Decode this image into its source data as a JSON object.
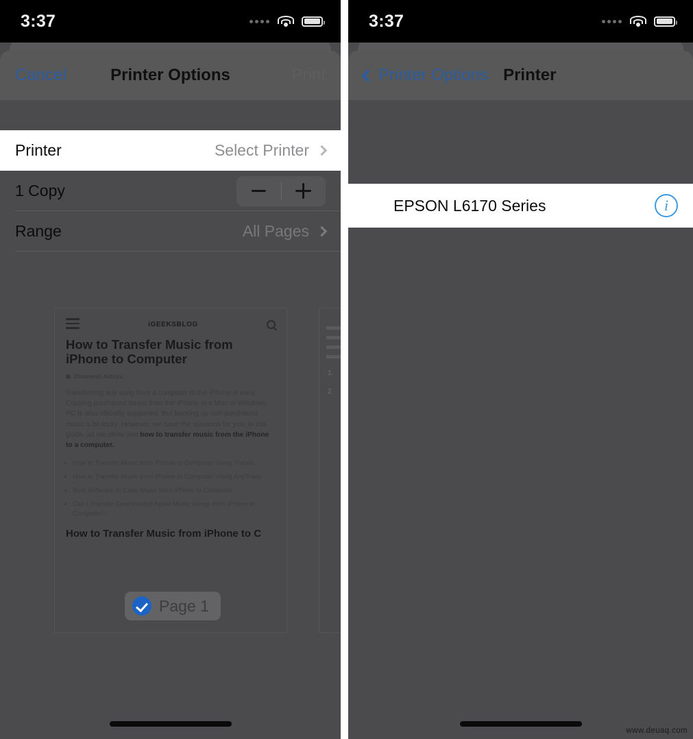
{
  "status_bar": {
    "time": "3:37",
    "icons": [
      "signal-dots-icon",
      "wifi-icon",
      "battery-icon"
    ]
  },
  "left_panel": {
    "nav": {
      "cancel_label": "Cancel",
      "title": "Printer Options",
      "print_label": "Print",
      "cancel_color": "#2d5c9e",
      "print_disabled": true
    },
    "rows": [
      {
        "label": "Printer",
        "value": "Select Printer",
        "accessory": "chevron-right-icon",
        "highlighted": true
      },
      {
        "label": "1 Copy",
        "value": "",
        "accessory": "stepper",
        "highlighted": false
      },
      {
        "label": "Range",
        "value": "All Pages",
        "accessory": "chevron-right-icon",
        "highlighted": false
      }
    ],
    "stepper": {
      "minus_label": "−",
      "plus_label": "+"
    },
    "preview": {
      "badge_label": "Page 1",
      "badge_checked": true,
      "document": {
        "site_logo": "iGEEKSBLOG",
        "title": "How to Transfer Music from iPhone to Computer",
        "byline": "Dhvanesh Adhiya",
        "paragraph_plain": "Transferring any song from a computer to the iPhone is easy. Copying purchased music from the iPhone to a Mac or Windows PC is also officially supported. But backing up non-purchased music a bit tricky. However, we have the solutions for you. In this guide, let me show you ",
        "paragraph_bold": "how to transfer music from the iPhone to a computer.",
        "toc": [
          "How to Transfer Music from iPhone to Computer Using iTunes",
          "How to Transfer Music from iPhone to Computer Using AnyTrans",
          "Best Software to Copy Music from iPhone to Computer",
          "Can I Transfer Downloaded Apple Music Songs from iPhone to Computer?"
        ],
        "subheading": "How to Transfer Music from iPhone to C",
        "page2_markers": [
          "1.",
          "2."
        ]
      }
    }
  },
  "right_panel": {
    "nav": {
      "back_label": "Printer Options",
      "title": "Printer",
      "back_color": "#2d5c9e"
    },
    "printers": [
      {
        "name": "EPSON L6170 Series",
        "accessory": "info-icon"
      }
    ]
  },
  "watermark": "www.deuaq.com"
}
